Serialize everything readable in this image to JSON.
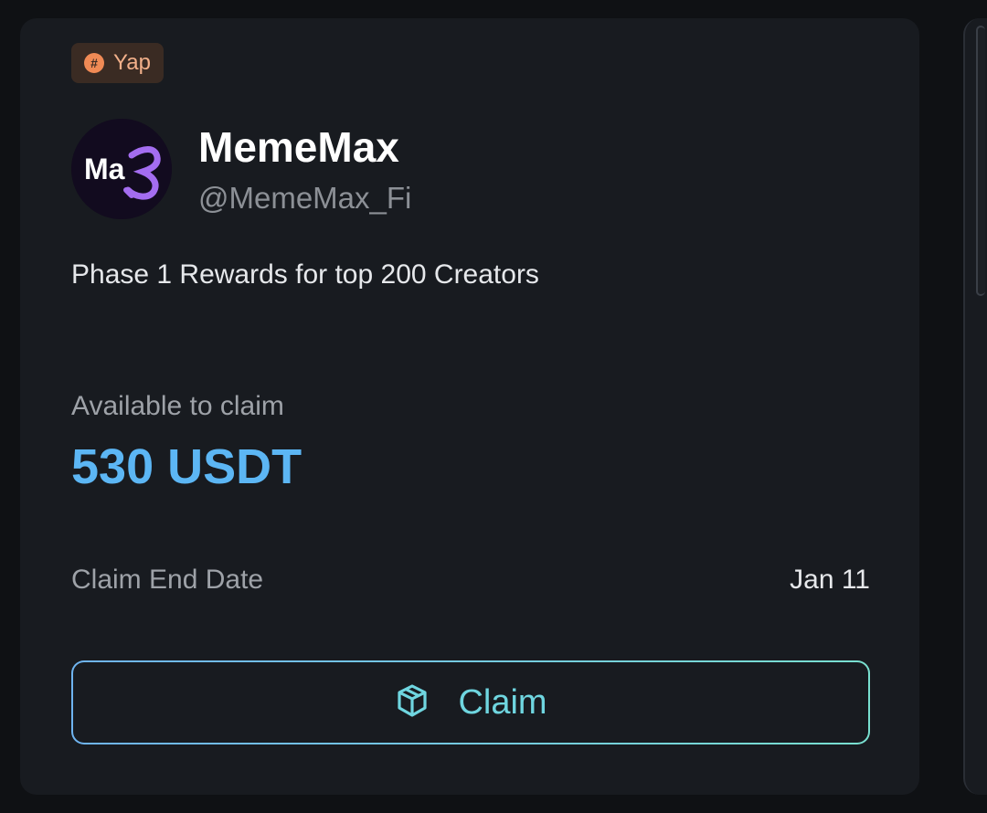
{
  "tag": {
    "label": "Yap",
    "icon": "hashtag-icon"
  },
  "project": {
    "name": "MemeMax",
    "handle": "@MemeMax_Fi",
    "avatar_text": "MaX"
  },
  "description": "Phase 1 Rewards for top 200 Creators",
  "claim": {
    "available_label": "Available to claim",
    "amount": "530 USDT",
    "end_date_label": "Claim End Date",
    "end_date_value": "Jan 11",
    "button_label": "Claim",
    "button_icon": "box-icon"
  },
  "colors": {
    "amount": "#5cb6f4",
    "button_gradient_start": "#6fb4f0",
    "button_gradient_end": "#79e0d0",
    "tag_bg": "#3a2b23",
    "tag_text": "#f2b08a"
  }
}
